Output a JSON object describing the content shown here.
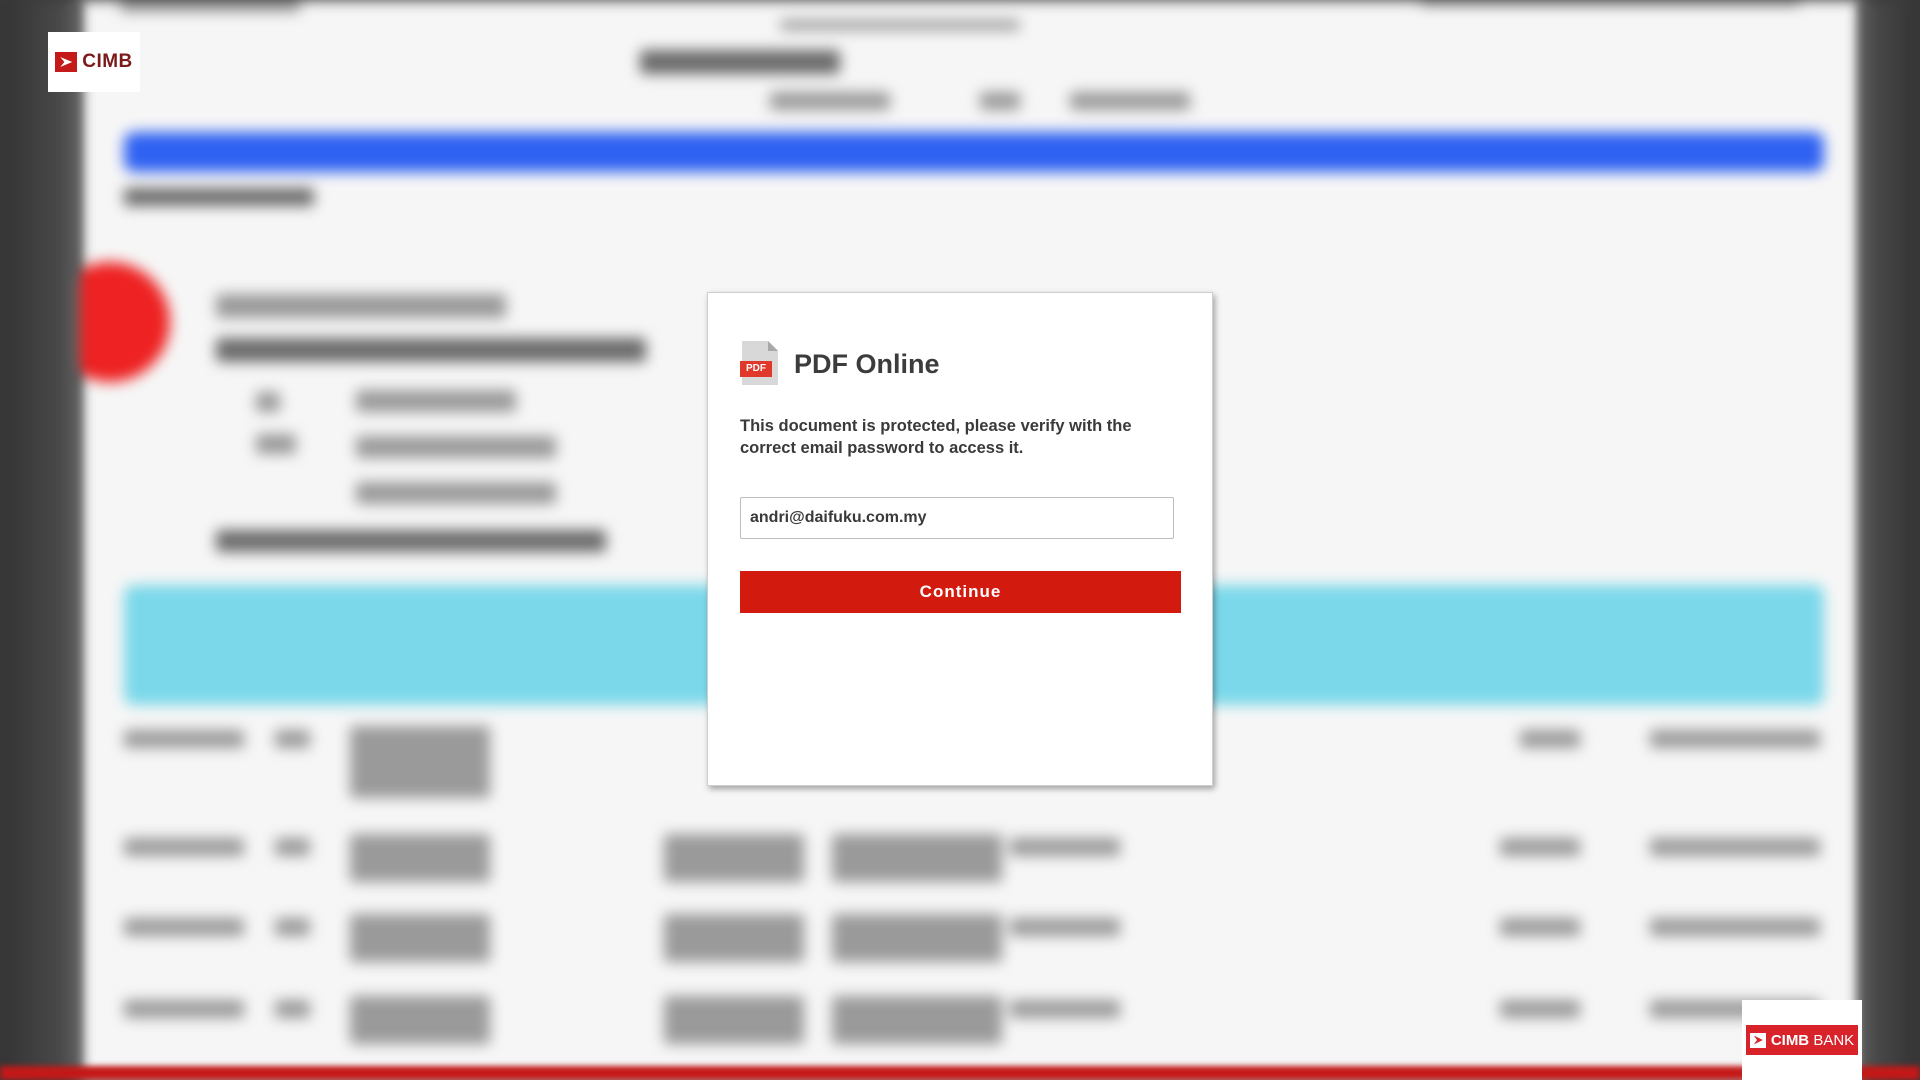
{
  "header": {
    "logo_text": "CIMB"
  },
  "footer": {
    "bank_logo_text": "CIMB",
    "bank_logo_suffix": "BANK"
  },
  "dialog": {
    "title": "PDF Online",
    "icon": "pdf-file-icon",
    "icon_tag": "PDF",
    "message": "This document is protected, please verify with the correct email password to access it.",
    "email_value": "andri@daifuku.com.my",
    "continue_label": "Continue"
  },
  "colors": {
    "brand_red": "#d31a0f",
    "cimb_red": "#c41a1a",
    "doc_band_blue": "#2f62f2",
    "doc_band_cyan": "#7ad8ea"
  }
}
